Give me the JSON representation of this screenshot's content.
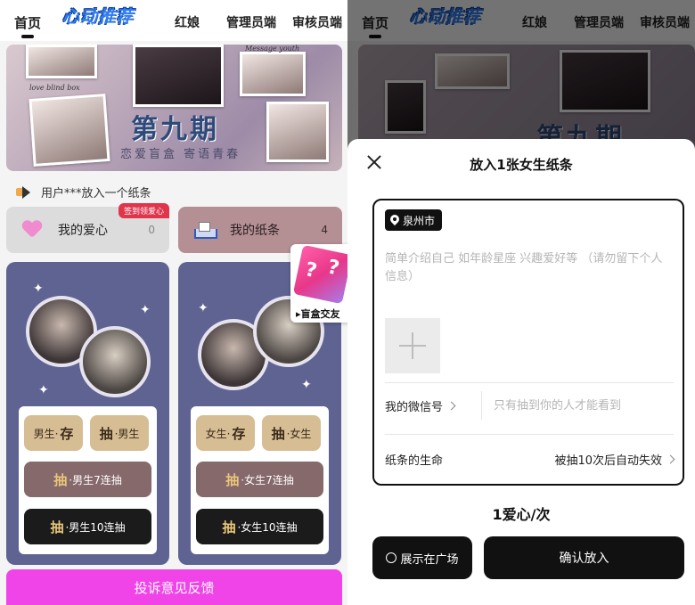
{
  "nav": {
    "home": "首页",
    "logo": "心动推荐",
    "matchmaker": "红娘",
    "admin": "管理员端",
    "reviewer": "审核员端"
  },
  "banner": {
    "title": "第九期",
    "subtitle": "恋爱盲盒 寄语青春",
    "caption_left": "love blind box",
    "caption_right": "Message youth"
  },
  "ticker": "用户***放入一个纸条",
  "stats": {
    "love_label": "我的爱心",
    "love_count": "0",
    "love_badge": "签到领爱心",
    "note_label": "我的纸条",
    "note_count": "4"
  },
  "male_box": {
    "store_prefix": "男生·",
    "store_verb": "存",
    "draw_verb": "抽",
    "draw_suffix": "·男生",
    "draw7_verb": "抽",
    "draw7_label": "·男生7连抽",
    "draw10_verb": "抽",
    "draw10_label": "·男生10连抽"
  },
  "female_box": {
    "store_prefix": "女生·",
    "store_verb": "存",
    "draw_verb": "抽",
    "draw_suffix": "·女生",
    "draw7_verb": "抽",
    "draw7_label": "·女生7连抽",
    "draw10_verb": "抽",
    "draw10_label": "·女生10连抽"
  },
  "floating": {
    "label": "▸盲盒交友"
  },
  "feedback": "投诉意见反馈",
  "sheet": {
    "title": "放入1张女生纸条",
    "city": "泉州市",
    "intro_placeholder": "简单介绍自己 如年龄星座 兴趣爱好等 （请勿留下个人信息）",
    "wechat_label": "我的微信号",
    "wechat_placeholder": "只有抽到你的人才能看到",
    "life_label": "纸条的生命",
    "life_value": "被抽10次后自动失效",
    "price": "1爱心/次",
    "square_label": "展示在广场",
    "confirm_label": "确认放入"
  },
  "colors": {
    "panel": "#5f6391",
    "tan": "#d6bd94",
    "mauve": "#86696b",
    "feedback": "#f044e8",
    "badge": "#e0354b"
  }
}
